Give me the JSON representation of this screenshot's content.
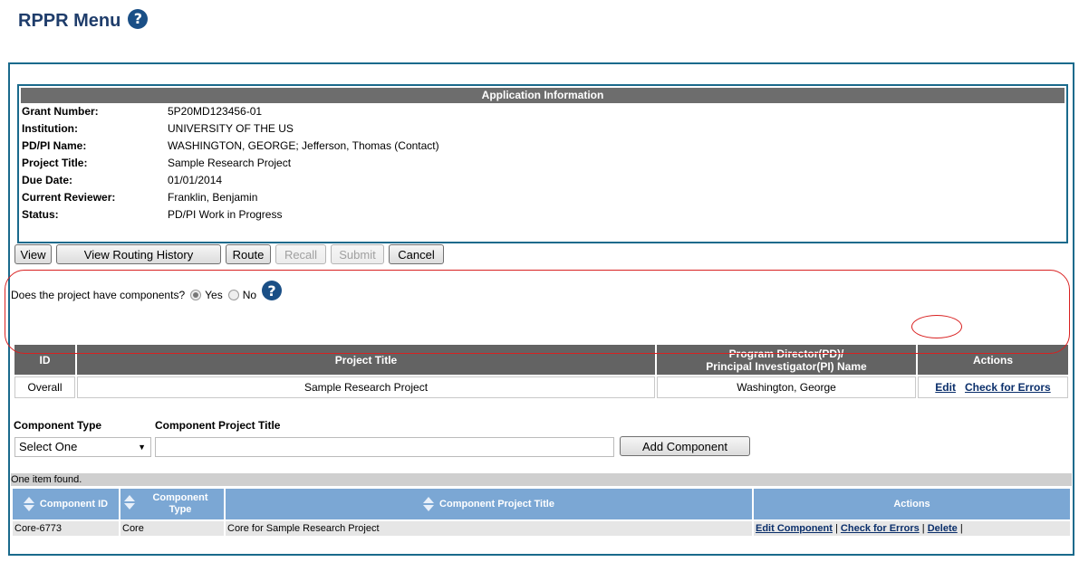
{
  "page": {
    "title": "RPPR Menu",
    "help_glyph": "?"
  },
  "app_info": {
    "header": "Application Information",
    "rows": [
      {
        "label": "Grant Number:",
        "value": "5P20MD123456-01"
      },
      {
        "label": "Institution:",
        "value": "UNIVERSITY OF THE US"
      },
      {
        "label": "PD/PI Name:",
        "value": "WASHINGTON, GEORGE; Jefferson, Thomas (Contact)"
      },
      {
        "label": "Project Title:",
        "value": "Sample Research Project"
      },
      {
        "label": "Due Date:",
        "value": "01/01/2014"
      },
      {
        "label": "Current Reviewer:",
        "value": "Franklin, Benjamin"
      },
      {
        "label": "Status:",
        "value": "PD/PI Work in Progress"
      }
    ]
  },
  "toolbar": {
    "view": "View",
    "view_routing_history": "View Routing History",
    "route": "Route",
    "recall": "Recall",
    "submit": "Submit",
    "cancel": "Cancel"
  },
  "components_question": {
    "text": "Does the project have components?",
    "yes": "Yes",
    "no": "No",
    "selected": "Yes"
  },
  "project_table": {
    "headers": {
      "id": "ID",
      "title": "Project Title",
      "pd_line1": "Program Director(PD)/",
      "pd_line2": "Principal Investigator(PI) Name",
      "actions": "Actions"
    },
    "row": {
      "id": "Overall",
      "title": "Sample Research Project",
      "pd": "Washington, George",
      "edit": "Edit",
      "check": "Check for Errors"
    }
  },
  "component_form": {
    "type_label": "Component Type",
    "title_label": "Component Project Title",
    "type_selected": "Select One",
    "title_value": "",
    "add_button": "Add Component"
  },
  "results": {
    "count_text": "One item found."
  },
  "component_table": {
    "headers": {
      "id": "Component ID",
      "type_line1": "Component",
      "type_line2": "Type",
      "title": "Component Project Title",
      "actions": "Actions"
    },
    "rows": [
      {
        "id": "Core-6773",
        "type": "Core",
        "title": "Core for Sample Research Project",
        "edit": "Edit Component",
        "check": "Check for Errors",
        "delete": "Delete"
      }
    ]
  },
  "colors": {
    "title": "#1f3d6b",
    "border": "#1a6a8c",
    "header_gray": "#636363",
    "header_blue": "#7ba7d4",
    "highlight": "#d92020"
  }
}
